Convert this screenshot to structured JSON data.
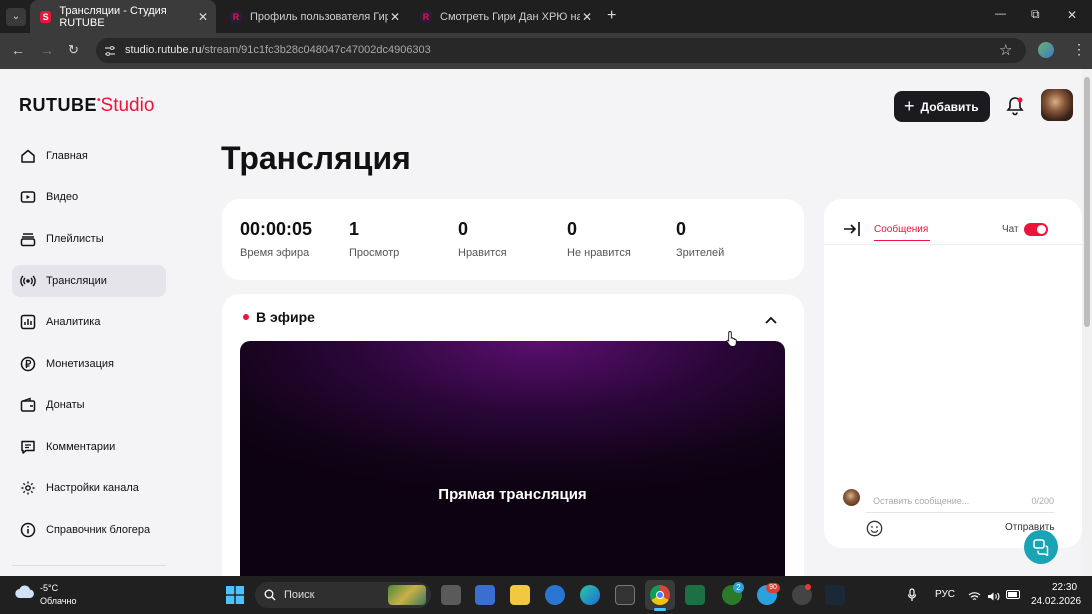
{
  "browser": {
    "tabs": [
      {
        "title": "Трансляции - Студия RUTUBE",
        "active": true
      },
      {
        "title": "Профиль пользователя Гири Д",
        "active": false
      },
      {
        "title": "Смотреть Гири Дан ХРЮ на R",
        "active": false
      }
    ],
    "new_tab": "+",
    "address": {
      "host": "studio.rutube.ru",
      "path": "/stream/91c1fc3b28c048047c47002dc4906303"
    },
    "window": {
      "minimize": "—",
      "maximize": "⧉",
      "close": "✕"
    }
  },
  "header": {
    "logo_main": "RUTUBE",
    "logo_sub": "Studio",
    "add_button": "Добавить"
  },
  "sidebar": {
    "items": [
      {
        "label": "Главная",
        "icon": "home-icon"
      },
      {
        "label": "Видео",
        "icon": "video-icon"
      },
      {
        "label": "Плейлисты",
        "icon": "playlist-icon"
      },
      {
        "label": "Трансляции",
        "icon": "broadcast-icon",
        "active": true
      },
      {
        "label": "Аналитика",
        "icon": "analytics-icon"
      },
      {
        "label": "Монетизация",
        "icon": "ruble-icon"
      },
      {
        "label": "Донаты",
        "icon": "wallet-icon"
      },
      {
        "label": "Комментарии",
        "icon": "comment-icon"
      },
      {
        "label": "Настройки канала",
        "icon": "gear-icon"
      },
      {
        "label": "Справочник блогера",
        "icon": "info-icon"
      }
    ]
  },
  "main": {
    "title": "Трансляция",
    "stats": [
      {
        "value": "00:00:05",
        "label": "Время эфира"
      },
      {
        "value": "1",
        "label": "Просмотр"
      },
      {
        "value": "0",
        "label": "Нравится"
      },
      {
        "value": "0",
        "label": "Не нравится"
      },
      {
        "value": "0",
        "label": "Зрителей"
      }
    ],
    "live_label": "В эфире",
    "video_text": "Прямая трансляция"
  },
  "chat": {
    "tab_messages": "Сообщения",
    "chat_label": "Чат",
    "chat_enabled": true,
    "input_placeholder": "Оставить сообщение...",
    "counter": "0/200",
    "send": "Отправить"
  },
  "taskbar": {
    "temp": "-5°C",
    "weather": "Облачно",
    "search": "Поиск",
    "lang": "РУС",
    "time": "22:30",
    "date": "24.02.2026",
    "badges": {
      "telegram": "2",
      "vk": "90"
    }
  },
  "colors": {
    "brand": "#ed143b",
    "dark": "#111111",
    "accent_teal": "#1aa3b5"
  }
}
